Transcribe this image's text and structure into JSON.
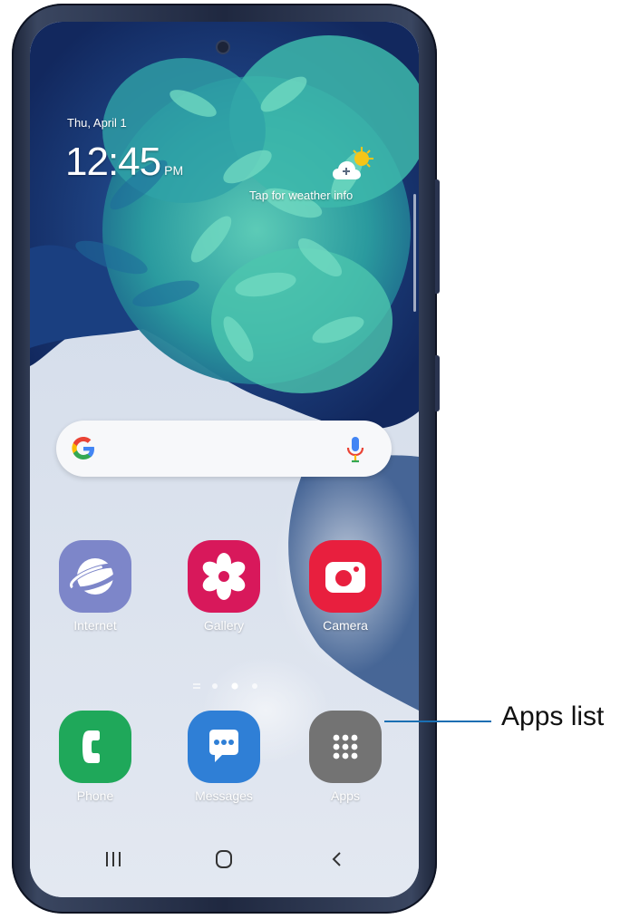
{
  "lock_info": {
    "date": "Thu, April 1",
    "time": "12:45",
    "ampm": "PM"
  },
  "weather": {
    "label": "Tap for weather info",
    "icon": "partly-sunny-add-icon"
  },
  "search_bar": {
    "logo": "google-g-icon",
    "mic": "microphone-icon"
  },
  "apps_row1": [
    {
      "label": "Internet",
      "icon": "internet-planet-icon",
      "color": "#7d86c9"
    },
    {
      "label": "Gallery",
      "icon": "gallery-flower-icon",
      "color": "#d8185b"
    },
    {
      "label": "Camera",
      "icon": "camera-icon",
      "color": "#e81f3e"
    }
  ],
  "dock": [
    {
      "label": "Phone",
      "icon": "phone-handset-icon",
      "color": "#1fa85a"
    },
    {
      "label": "Messages",
      "icon": "message-bubble-icon",
      "color": "#2f7fd6"
    },
    {
      "label": "Apps",
      "icon": "apps-grid-icon",
      "color": "#737373"
    }
  ],
  "nav_bar": {
    "recents": "recents-icon",
    "home": "home-icon",
    "back": "back-icon"
  },
  "callout": {
    "label": "Apps list"
  },
  "colors": {
    "phone_frame": "#1f2840",
    "callout_line": "#1a6fb3",
    "search_bg": "#f7f8fa"
  }
}
